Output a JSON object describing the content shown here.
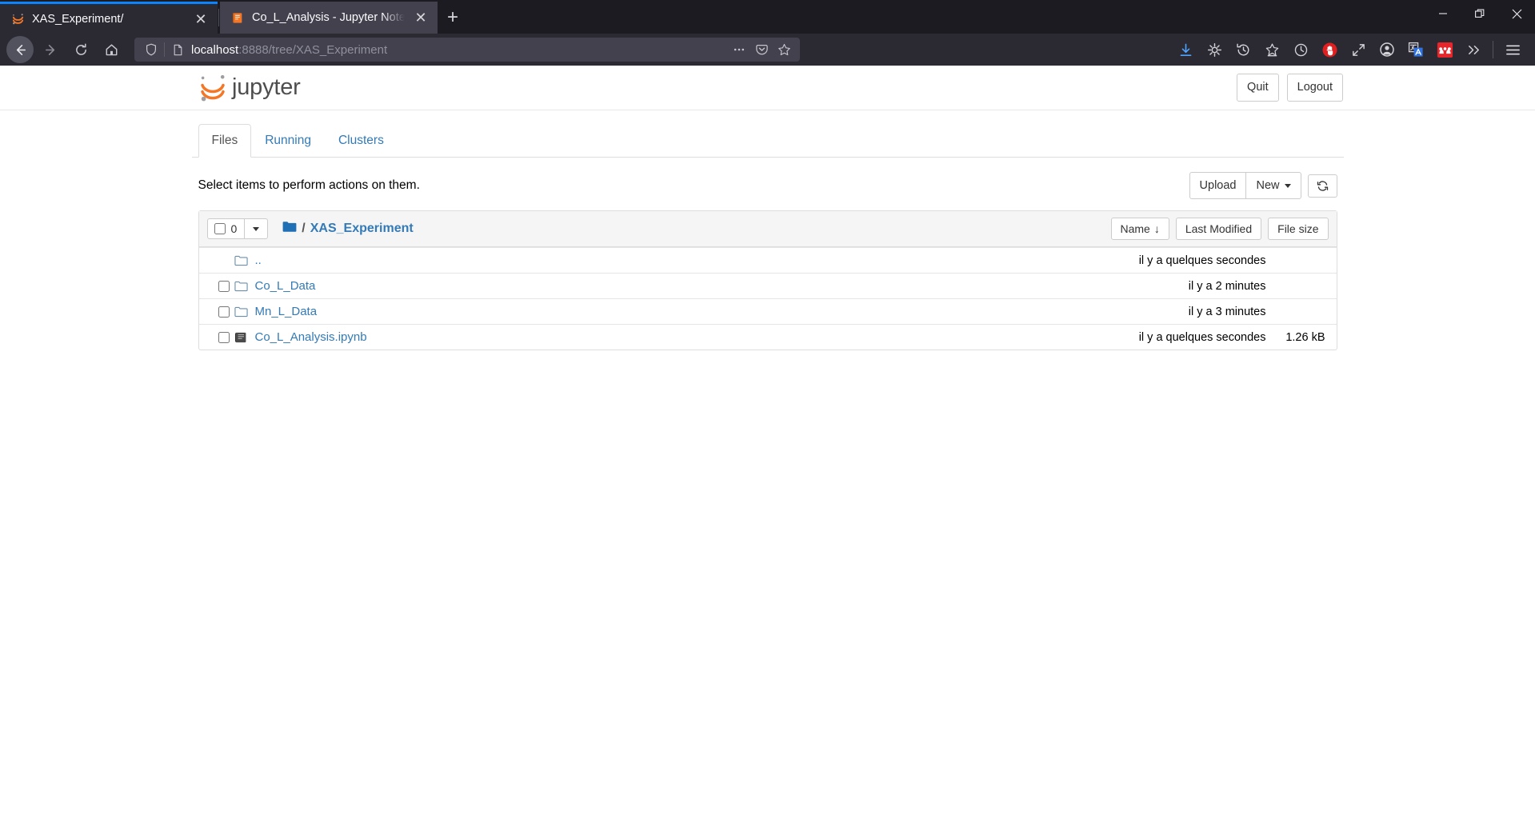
{
  "browser": {
    "tabs": [
      {
        "title": "XAS_Experiment/",
        "favicon": "jupyter-icon",
        "active": false
      },
      {
        "title": "Co_L_Analysis - Jupyter Notebook",
        "favicon": "notebook-icon",
        "active": true
      }
    ],
    "new_tab_label": "+",
    "close_label": "✕",
    "url": {
      "host": "localhost",
      "path": ":8888/tree/XAS_Experiment",
      "full": "localhost:8888/tree/XAS_Experiment"
    },
    "nav": {
      "back": "back-icon",
      "forward": "forward-icon",
      "reload": "reload-icon",
      "home": "home-icon"
    },
    "url_actions": [
      "more-icon",
      "pocket-icon",
      "bookmark-star-icon"
    ],
    "toolbar_icons": [
      "downloads-icon",
      "settings-gear-icon",
      "history-icon",
      "bookmarks-icon",
      "clock-icon",
      "blocker-stop-icon",
      "fullscreen-expand-icon",
      "account-icon",
      "translate-icon",
      "mendeley-icon",
      "overflow-chevrons-icon",
      "app-menu-icon"
    ],
    "window_controls": [
      "minimize",
      "restore",
      "close"
    ]
  },
  "jupyter": {
    "logo_text": "jupyter",
    "logo_color": "#f37726",
    "header_buttons": [
      {
        "label": "Quit",
        "name": "quit-button"
      },
      {
        "label": "Logout",
        "name": "logout-button"
      }
    ],
    "tabs": [
      {
        "label": "Files",
        "active": true
      },
      {
        "label": "Running",
        "active": false
      },
      {
        "label": "Clusters",
        "active": false
      }
    ],
    "select_message": "Select items to perform actions on them.",
    "action_buttons": [
      {
        "label": "Upload",
        "name": "upload-button"
      },
      {
        "label": "New",
        "name": "new-button",
        "has_caret": true
      }
    ],
    "refresh_label": "refresh-icon",
    "selected_count": "0",
    "breadcrumb": {
      "root_icon": "folder-icon",
      "separator": "/",
      "current": "XAS_Experiment"
    },
    "sort_buttons": [
      {
        "label": "Name",
        "sort_arrow": "↓",
        "name": "sort-name-button"
      },
      {
        "label": "Last Modified",
        "sort_arrow": "",
        "name": "sort-modified-button"
      },
      {
        "label": "File size",
        "sort_arrow": "",
        "name": "sort-filesize-button"
      }
    ],
    "columns": {
      "name": "Name",
      "modified": "Last Modified",
      "size": "File size"
    },
    "files": [
      {
        "name": "..",
        "type": "parent-folder",
        "icon": "folder-icon",
        "modified": "il y a quelques secondes",
        "size": "",
        "has_checkbox": false
      },
      {
        "name": "Co_L_Data",
        "type": "folder",
        "icon": "folder-icon",
        "modified": "il y a 2 minutes",
        "size": "",
        "has_checkbox": true
      },
      {
        "name": "Mn_L_Data",
        "type": "folder",
        "icon": "folder-icon",
        "modified": "il y a 3 minutes",
        "size": "",
        "has_checkbox": true
      },
      {
        "name": "Co_L_Analysis.ipynb",
        "type": "notebook",
        "icon": "notebook-icon",
        "modified": "il y a quelques secondes",
        "size": "1.26 kB",
        "has_checkbox": true
      }
    ]
  },
  "colors": {
    "jupyter_orange": "#f37726",
    "link_blue": "#337ab7",
    "chrome_dark": "#1c1b22",
    "tab_active": "#42414d",
    "tab_inactive": "#2b2a33",
    "accent_blue": "#0a84ff"
  }
}
